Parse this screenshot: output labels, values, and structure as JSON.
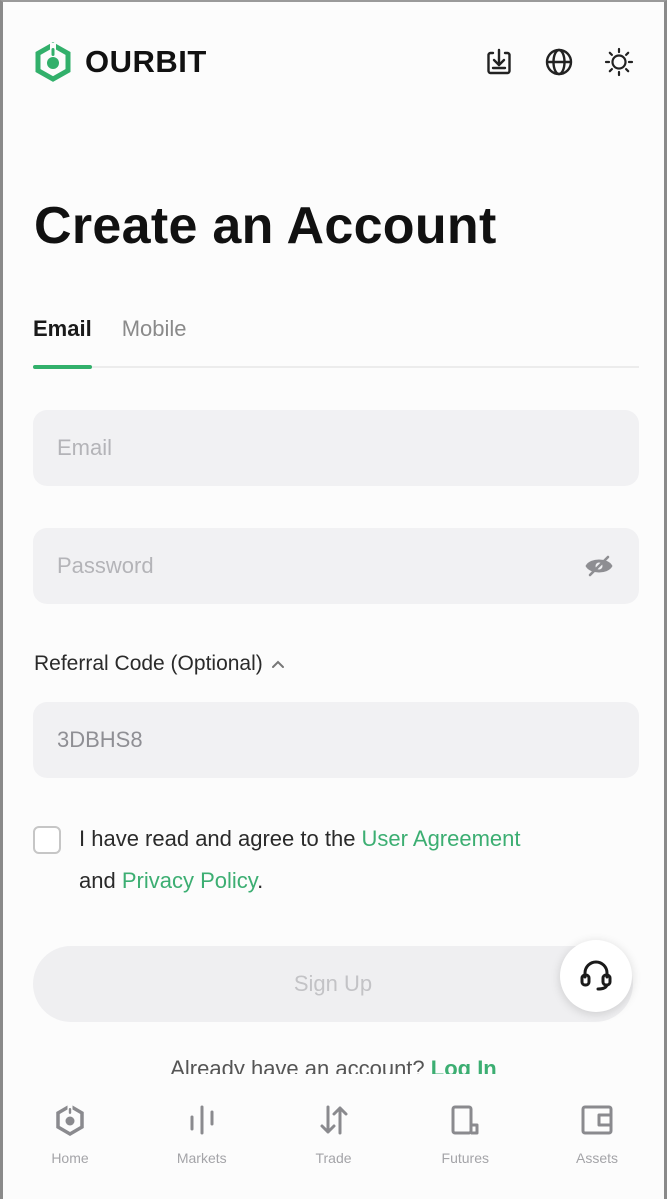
{
  "brand": {
    "name": "OURBIT",
    "accent_color": "#32b06b"
  },
  "header": {
    "actions": [
      {
        "name": "download-icon"
      },
      {
        "name": "globe-icon"
      },
      {
        "name": "theme-sun-icon"
      }
    ]
  },
  "page": {
    "title": "Create an Account"
  },
  "tabs": [
    {
      "label": "Email",
      "active": true
    },
    {
      "label": "Mobile",
      "active": false
    }
  ],
  "form": {
    "email": {
      "placeholder": "Email",
      "value": ""
    },
    "password": {
      "placeholder": "Password",
      "value": ""
    },
    "referral": {
      "label": "Referral Code (Optional)",
      "value": "3DBHS8"
    },
    "agreement": {
      "prefix": "I have read and agree to the ",
      "user_agreement": "User Agreement",
      "middle": "and ",
      "privacy_policy": "Privacy Policy",
      "suffix": "."
    },
    "submit_label": "Sign Up"
  },
  "login_prompt": {
    "text": "Already have an account? ",
    "link": "Log In"
  },
  "bottom_nav": [
    {
      "label": "Home",
      "icon": "home-icon"
    },
    {
      "label": "Markets",
      "icon": "markets-icon"
    },
    {
      "label": "Trade",
      "icon": "trade-icon"
    },
    {
      "label": "Futures",
      "icon": "futures-icon"
    },
    {
      "label": "Assets",
      "icon": "assets-icon"
    }
  ]
}
